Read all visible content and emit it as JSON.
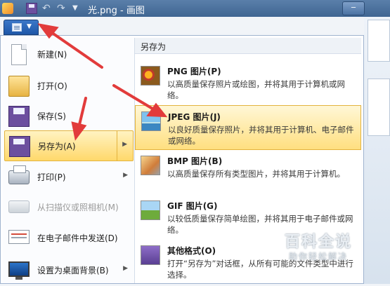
{
  "titlebar": {
    "title": "光.png - 画图"
  },
  "app_menu": {
    "items": [
      {
        "label": "新建(N)",
        "icon": "new-document-icon"
      },
      {
        "label": "打开(O)",
        "icon": "open-folder-icon"
      },
      {
        "label": "保存(S)",
        "icon": "save-disk-icon"
      },
      {
        "label": "另存为(A)",
        "icon": "save-as-icon"
      },
      {
        "label": "打印(P)",
        "icon": "printer-icon"
      },
      {
        "label": "从扫描仪或照相机(M)",
        "icon": "scanner-icon"
      },
      {
        "label": "在电子邮件中发送(D)",
        "icon": "email-icon"
      },
      {
        "label": "设置为桌面背景(B)",
        "icon": "desktop-background-icon"
      }
    ]
  },
  "save_as_panel": {
    "header": "另存为",
    "formats": [
      {
        "title": "PNG 图片(P)",
        "desc": "以高质量保存照片或绘图，并将其用于计算机或网络。"
      },
      {
        "title": "JPEG 图片(J)",
        "desc": "以良好质量保存照片，并将其用于计算机、电子邮件或网络。"
      },
      {
        "title": "BMP 图片(B)",
        "desc": "以高质量保存所有类型图片，并将其用于计算机。"
      },
      {
        "title": "GIF 图片(G)",
        "desc": "以较低质量保存简单绘图，并将其用于电子邮件或网络。"
      },
      {
        "title": "其他格式(O)",
        "desc": "打开“另存为”对话框，从所有可能的文件类型中进行选择。"
      }
    ]
  },
  "watermark": {
    "title": "百科全说",
    "subtitle": "助你轻松解决"
  },
  "colors": {
    "highlight": "#ffd86b",
    "arrow": "#e23b3b",
    "menu_button": "#1e57a8"
  }
}
